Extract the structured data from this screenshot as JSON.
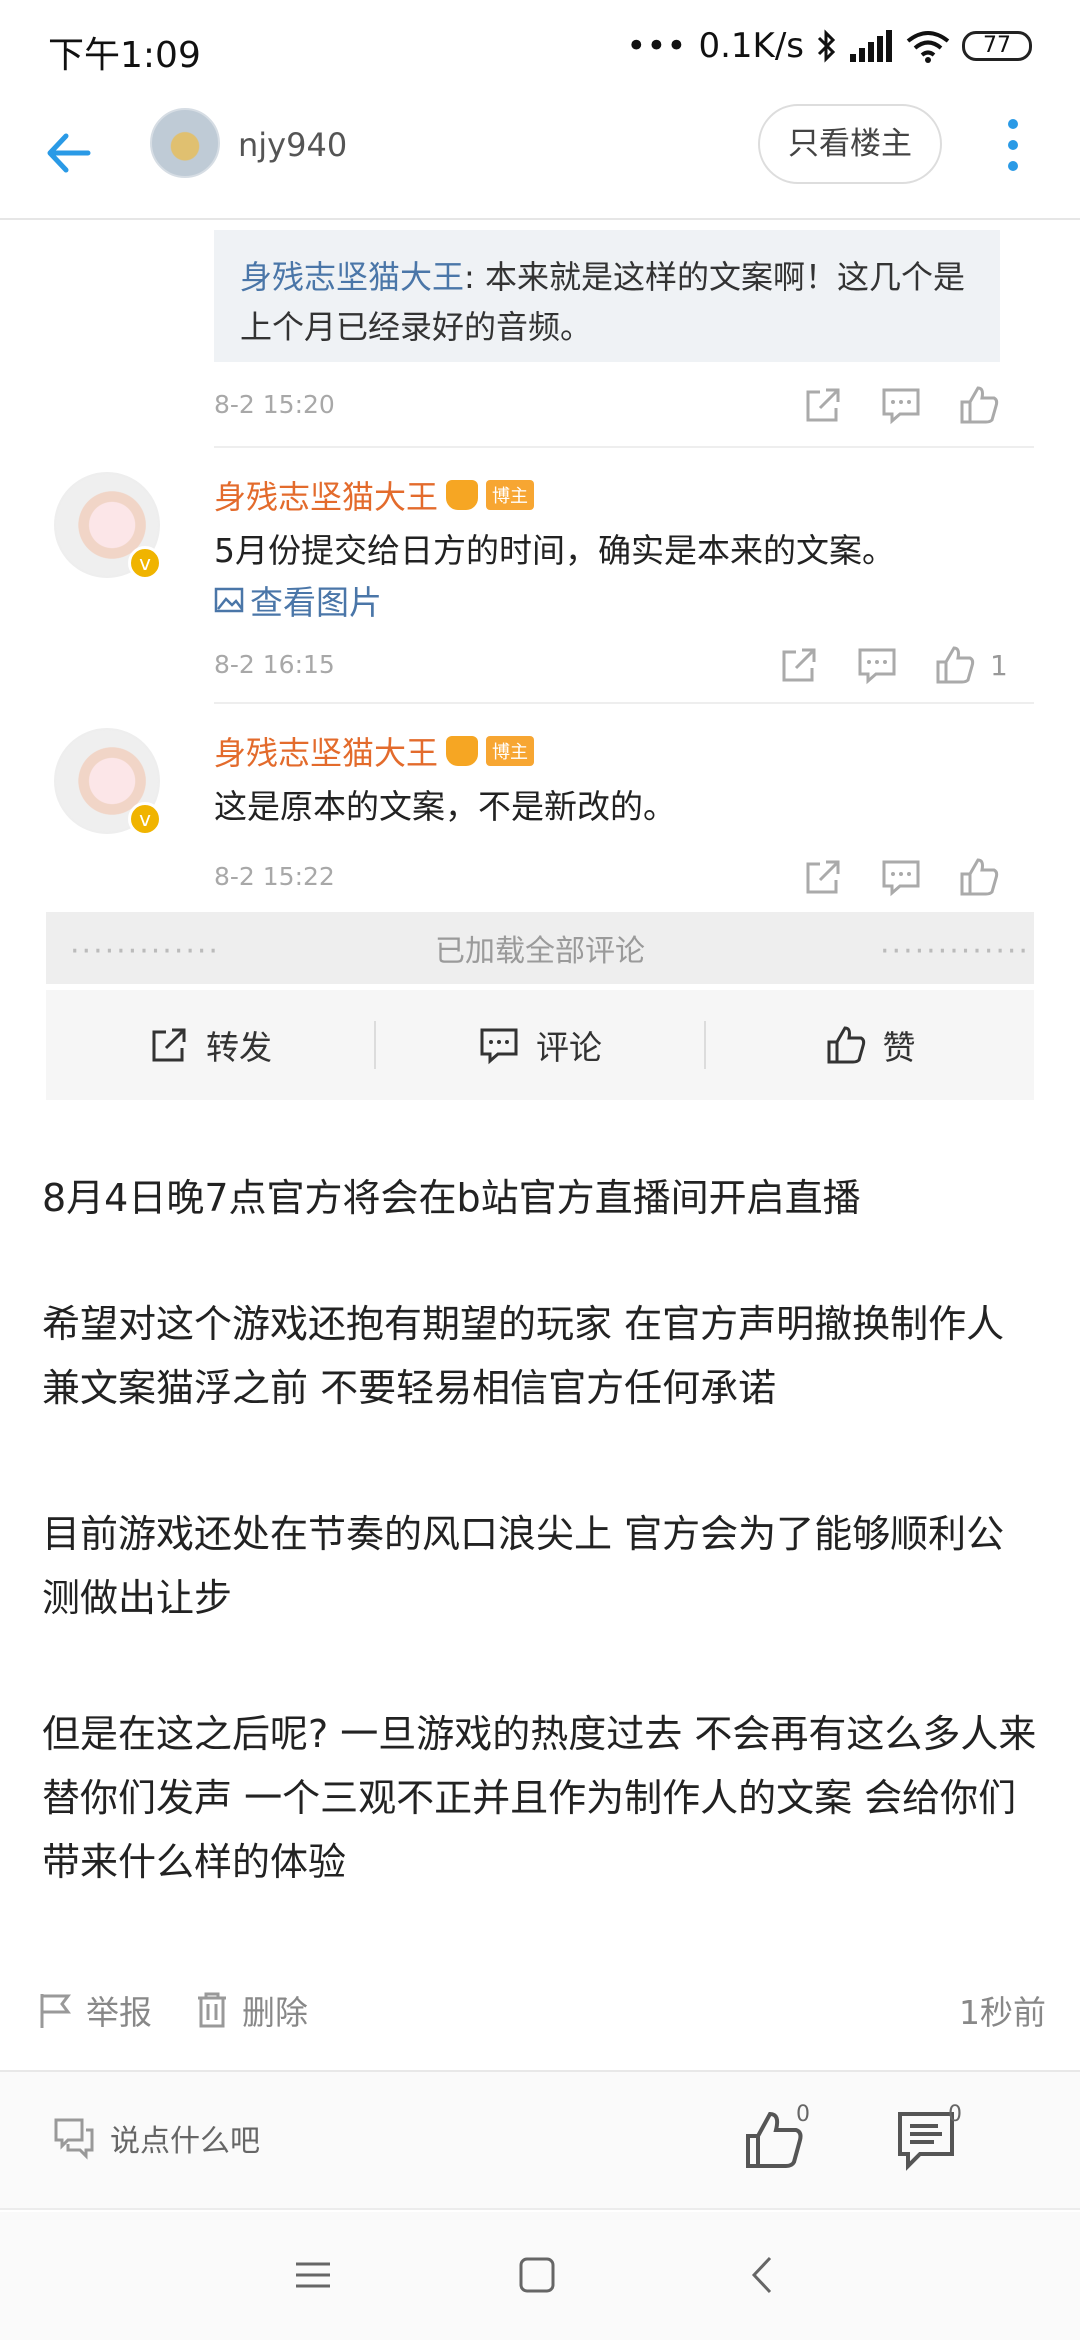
{
  "status_bar": {
    "time": "下午1:09",
    "net_speed": "0.1K/s",
    "battery": "77"
  },
  "header": {
    "back_icon": "back-arrow-icon",
    "username": "njy940",
    "only_op_label": "只看楼主",
    "more_icon": "more-vertical-icon"
  },
  "embedded_comments": {
    "quote": {
      "name": "身残志坚猫大王",
      "text": ": 本来就是这样的文案啊！这几个是上个月已经录好的音频。",
      "date": "8-2 15:20"
    },
    "comments": [
      {
        "name": "身残志坚猫大王",
        "tag": "博主",
        "text": "5月份提交给日方的时间，确实是本来的文案。",
        "link": "查看图片",
        "date": "8-2 16:15",
        "likes": "1"
      },
      {
        "name": "身残志坚猫大王",
        "tag": "博主",
        "text": "这是原本的文案，不是新改的。",
        "date": "8-2 15:22"
      }
    ],
    "loaded_all": "已加载全部评论",
    "dots": "·············",
    "actions": {
      "repost": "转发",
      "comment": "评论",
      "like": "赞"
    }
  },
  "post": {
    "paragraphs": [
      "8月4日晚7点官方将会在b站官方直播间开启直播",
      "希望对这个游戏还抱有期望的玩家 在官方声明撤换制作人兼文案猫浮之前 不要轻易相信官方任何承诺",
      "目前游戏还处在节奏的风口浪尖上 官方会为了能够顺利公测做出让步",
      "但是在这之后呢? 一旦游戏的热度过去 不会再有这么多人来替你们发声 一个三观不正并且作为制作人的文案 会给你们带来什么样的体验"
    ]
  },
  "tools": {
    "report": "举报",
    "delete": "删除",
    "time_ago": "1秒前"
  },
  "reply_bar": {
    "placeholder": "说点什么吧",
    "like_count": "0",
    "comment_count": "0"
  }
}
